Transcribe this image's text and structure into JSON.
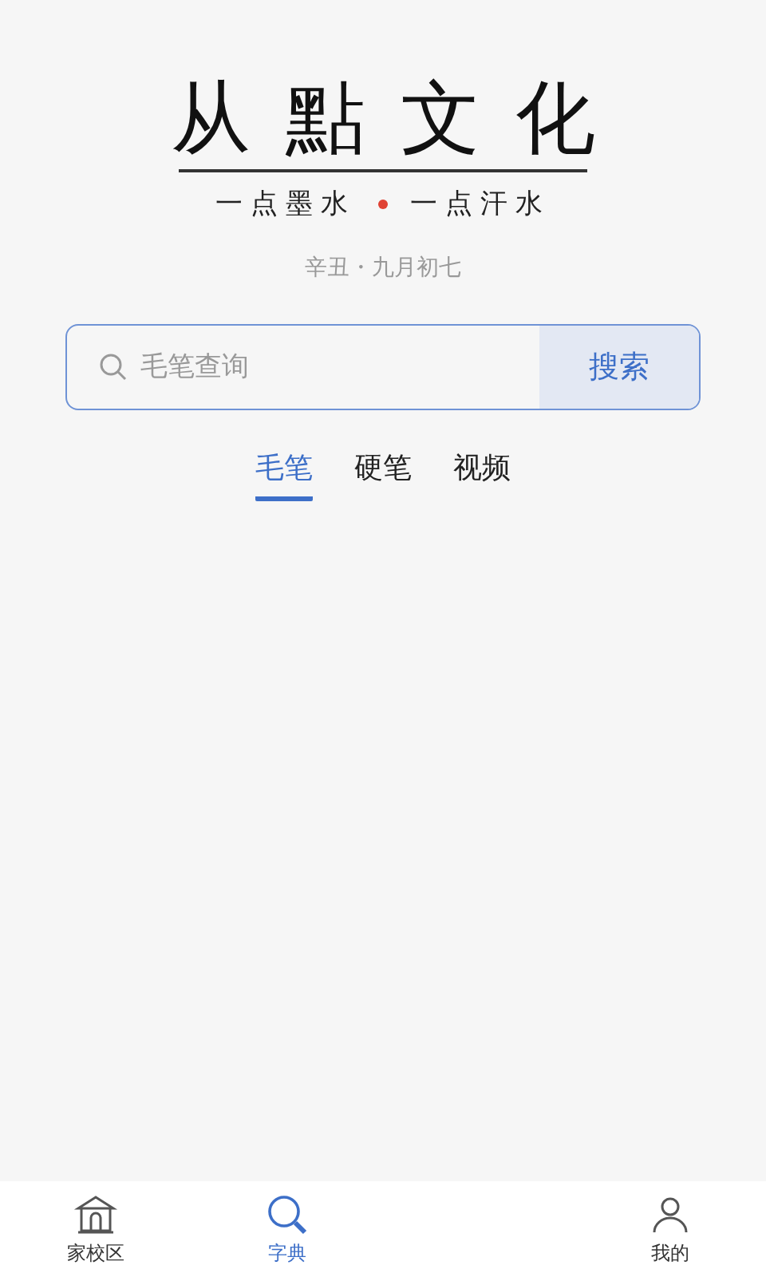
{
  "logo": {
    "title": "从點文化",
    "slogan_left": "一点墨水",
    "slogan_right": "一点汗水"
  },
  "date": "辛丑・九月初七",
  "search": {
    "placeholder": "毛笔查询",
    "button": "搜索"
  },
  "tabs": [
    {
      "label": "毛笔",
      "selected": true
    },
    {
      "label": "硬笔",
      "selected": false
    },
    {
      "label": "视频",
      "selected": false
    }
  ],
  "nav": [
    {
      "kind": "home",
      "label": "家校区",
      "selected": false
    },
    {
      "kind": "search",
      "label": "字典",
      "selected": true
    },
    {
      "kind": "hidden"
    },
    {
      "kind": "profile",
      "label": "我的",
      "selected": false
    }
  ]
}
